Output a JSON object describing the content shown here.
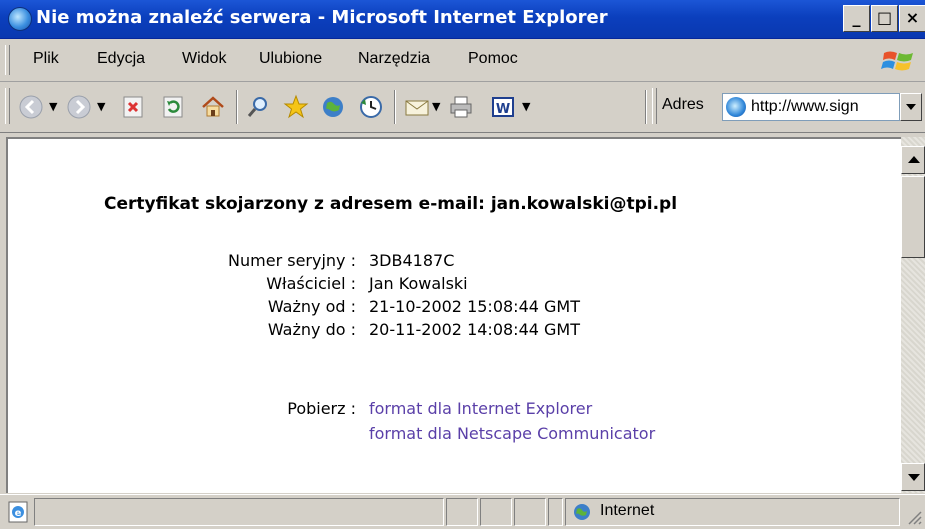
{
  "window": {
    "title": "Nie można znaleźć serwera - Microsoft Internet Explorer",
    "buttons": {
      "minimize": "_",
      "maximize": "□",
      "close": "×"
    }
  },
  "menu": {
    "items": [
      {
        "label": "Plik"
      },
      {
        "label": "Edycja"
      },
      {
        "label": "Widok"
      },
      {
        "label": "Ulubione"
      },
      {
        "label": "Narzędzia"
      },
      {
        "label": "Pomoc"
      }
    ]
  },
  "toolbar": {
    "icons": [
      "back-icon",
      "forward-icon",
      "stop-icon",
      "refresh-icon",
      "home-icon",
      "search-icon",
      "favorites-icon",
      "media-icon",
      "history-icon",
      "mail-icon",
      "print-icon",
      "word-edit-icon"
    ]
  },
  "address": {
    "label": "Adres",
    "value": "http://www.sign"
  },
  "content": {
    "heading": "Certyfikat skojarzony z adresem e-mail:  jan.kowalski@tpi.pl",
    "fields": [
      {
        "label": "Numer seryjny :",
        "value": "3DB4187C"
      },
      {
        "label": "Właściciel :",
        "value": "Jan Kowalski"
      },
      {
        "label": "Ważny od :",
        "value": "21-10-2002 15:08:44 GMT"
      },
      {
        "label": "Ważny do :",
        "value": "20-11-2002 14:08:44 GMT"
      }
    ],
    "download": {
      "label": "Pobierz :",
      "links": [
        {
          "label": "format dla Internet Explorer"
        },
        {
          "label": "format dla Netscape Communicator"
        }
      ]
    }
  },
  "status": {
    "zone": "Internet"
  },
  "colors": {
    "titlebar": "#0a3fbd",
    "link": "#5a3fa8",
    "chrome": "#d4d0c8"
  }
}
